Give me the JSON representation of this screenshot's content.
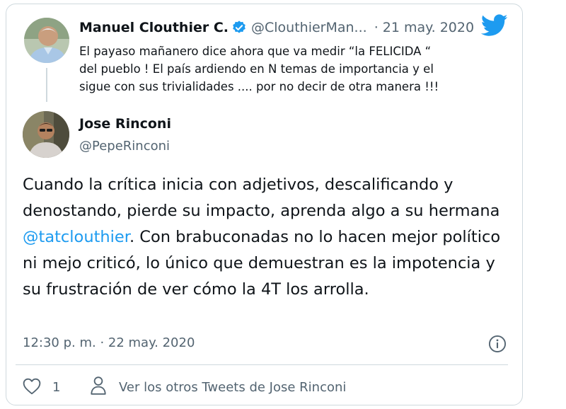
{
  "parent_tweet": {
    "author_name": "Manuel Clouthier C.",
    "handle": "@ClouthierMan...",
    "separator": "·",
    "date": "21 may. 2020",
    "text_lines": [
      "El payaso mañanero dice ahora que va medir “la FELICIDA “",
      "del pueblo ! El país ardiendo en N temas de importancia y el",
      "sigue con sus trivialidades .... por no decir de otra manera !!!"
    ]
  },
  "tweet": {
    "author_name": "Jose Rinconi",
    "handle": "@PepeRinconi",
    "text_before_mention": "Cuando la crítica inicia con adjetivos, descalificando y denostando, pierde su impacto, aprenda algo a su hermana ",
    "mention": "@tatclouthier",
    "text_after_mention": ". Con brabuconadas no lo hacen mejor político ni mejo criticó, lo único que demuestran es la impotencia y su frustración de ver cómo la 4T los arrolla.",
    "timestamp": "12:30 p. m. · 22 may. 2020"
  },
  "actions": {
    "like_count": "1",
    "more_tweets_label": "Ver los otros Tweets de Jose Rinconi"
  },
  "colors": {
    "accent": "#1d9bf0",
    "secondary_text": "#536471",
    "border": "#cfd9de"
  },
  "icons": [
    "verified-icon",
    "twitter-bird-icon",
    "info-icon",
    "heart-icon",
    "person-icon"
  ]
}
